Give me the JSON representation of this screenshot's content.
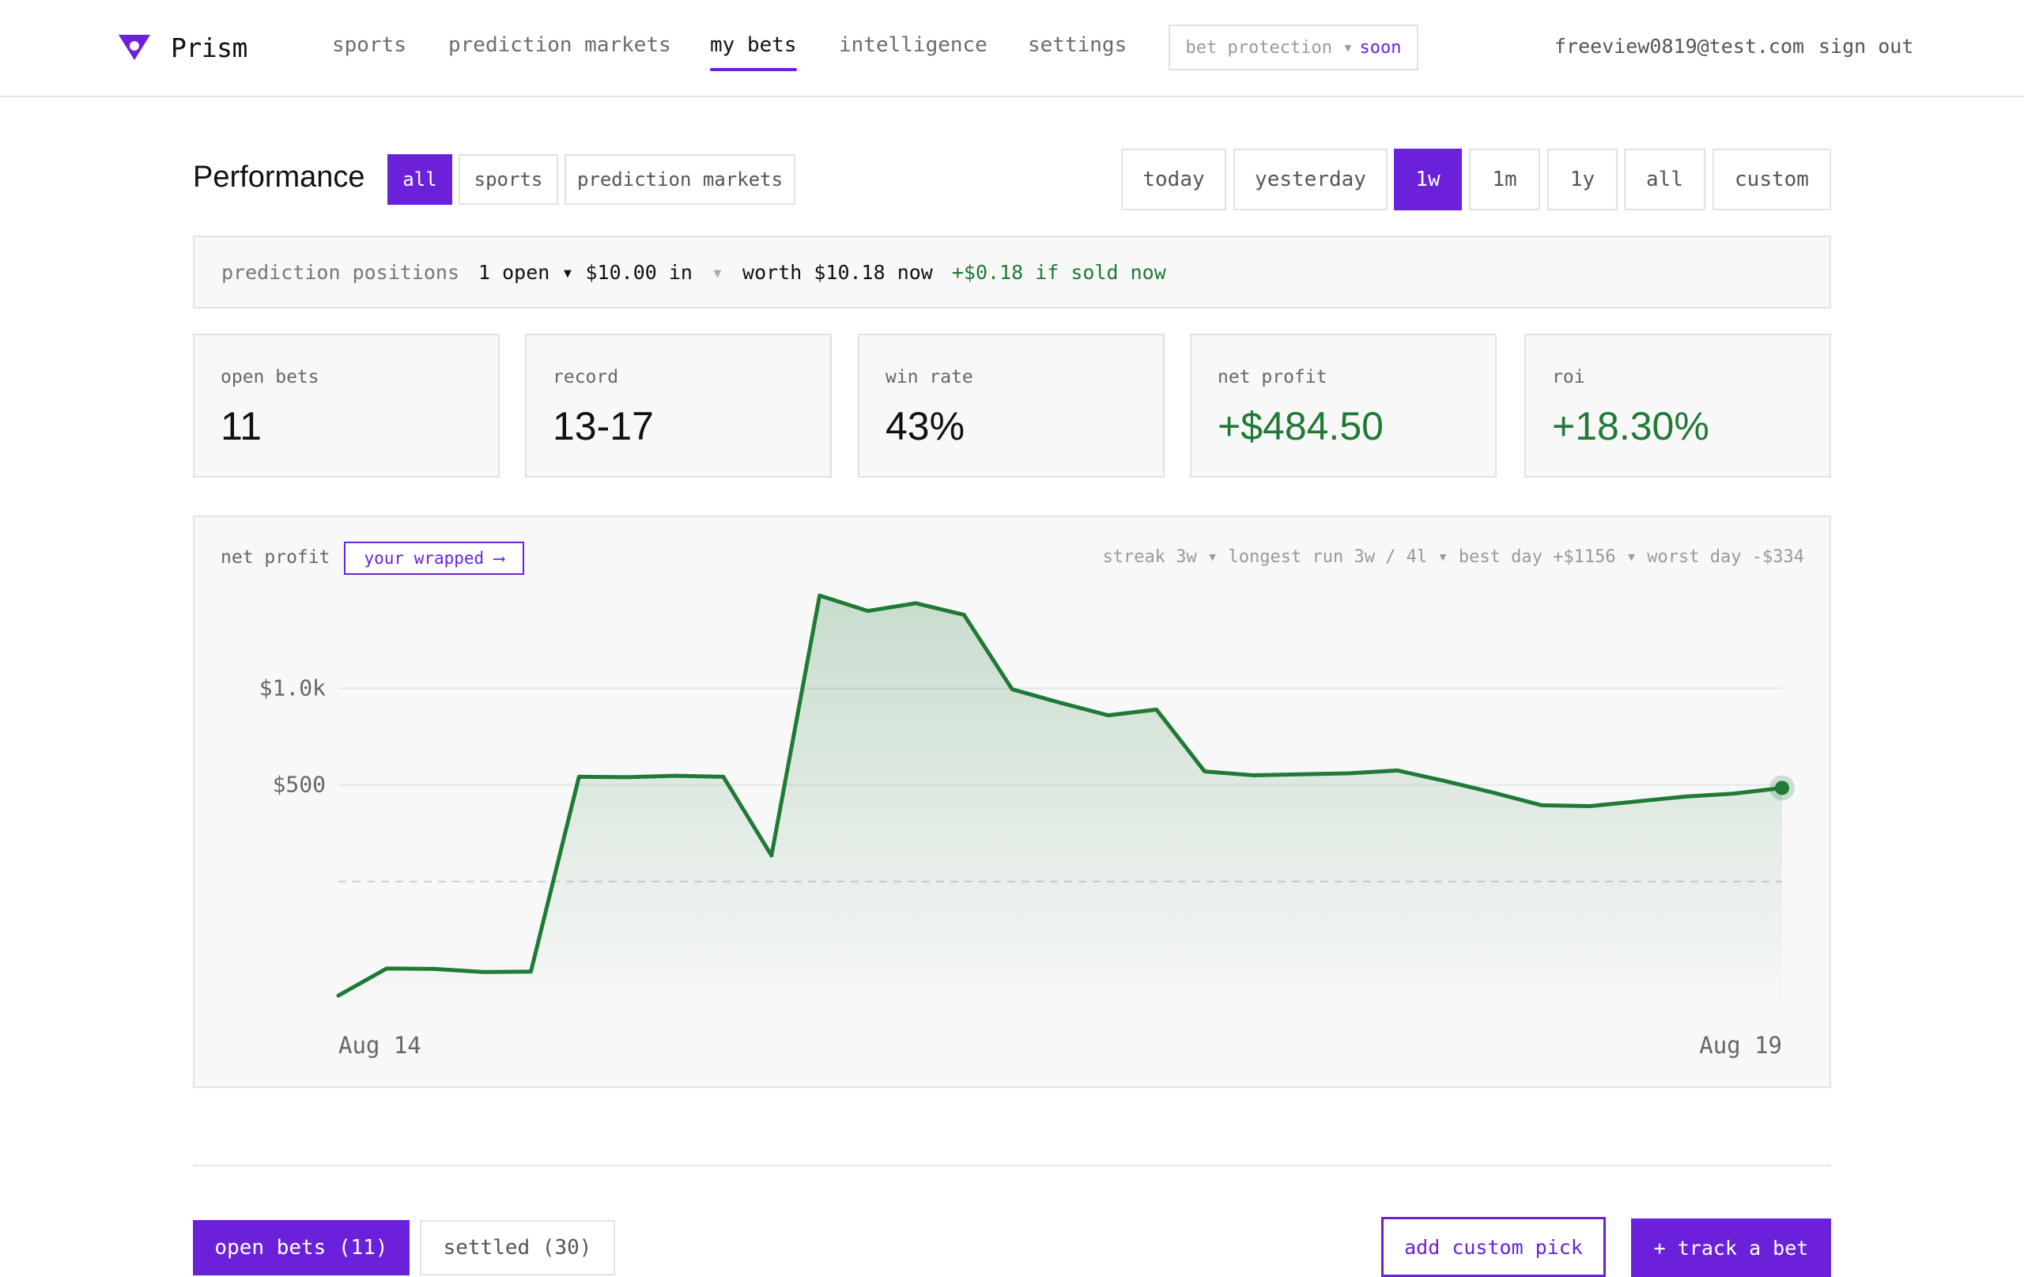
{
  "app": {
    "name": "Prism"
  },
  "nav": {
    "links": [
      {
        "label": "sports"
      },
      {
        "label": "prediction markets"
      },
      {
        "label": "my bets",
        "active": true
      },
      {
        "label": "intelligence"
      },
      {
        "label": "settings"
      }
    ],
    "bet_protection": {
      "label": "bet protection ▾",
      "badge": "soon"
    },
    "user_email": "freeview0819@test.com",
    "sign_out": "sign out"
  },
  "performance": {
    "title": "Performance",
    "filters": [
      {
        "label": "all",
        "selected": true
      },
      {
        "label": "sports"
      },
      {
        "label": "prediction markets"
      }
    ],
    "ranges": [
      {
        "label": "today"
      },
      {
        "label": "yesterday"
      },
      {
        "label": "1w",
        "selected": true
      },
      {
        "label": "1m"
      },
      {
        "label": "1y"
      },
      {
        "label": "all"
      },
      {
        "label": "custom"
      }
    ]
  },
  "prediction_positions": {
    "label": "prediction positions",
    "summary": "1 open ▾ $10.00 in",
    "separator": "▾",
    "worth": "worth $10.18 now",
    "gain": "+$0.18 if sold now"
  },
  "stats": [
    {
      "label": "open bets",
      "value": "11",
      "positive": false
    },
    {
      "label": "record",
      "value": "13-17",
      "positive": false
    },
    {
      "label": "win rate",
      "value": "43%",
      "positive": false
    },
    {
      "label": "net profit",
      "value": "+$484.50",
      "positive": true
    },
    {
      "label": "roi",
      "value": "+18.30%",
      "positive": true
    }
  ],
  "chart_panel": {
    "label": "net profit",
    "wrapped_button": "your wrapped ⟶",
    "stats_line": "streak 3w ▾ longest run 3w / 4l ▾ best day +$1156 ▾ worst day -$334"
  },
  "chart_data": {
    "type": "area",
    "title": "",
    "series": [
      {
        "values": [
          -590,
          -450,
          -452,
          -468,
          -466,
          542,
          540,
          547,
          542,
          135,
          1480,
          1400,
          1440,
          1380,
          995,
          925,
          860,
          890,
          570,
          550,
          555,
          560,
          575,
          520,
          460,
          395,
          390,
          415,
          440,
          455,
          484.5
        ]
      }
    ],
    "x_start_label": "Aug 14",
    "x_end_label": "Aug 19",
    "y_ticks": [
      {
        "value": 1000,
        "label": "$1.0k"
      },
      {
        "value": 500,
        "label": "$500"
      }
    ],
    "baseline": 0,
    "ylim": [
      -700,
      1550
    ],
    "colors": {
      "line": "#1f7a35",
      "fill": "#1f7a35",
      "grid": "#e6e6e6"
    }
  },
  "bottom": {
    "tabs": [
      {
        "label": "open bets (11)",
        "selected": true
      },
      {
        "label": "settled (30)"
      }
    ],
    "add_custom_pick": "add custom pick",
    "track_bet": "+ track a bet"
  },
  "colors": {
    "accent": "#6b21d9",
    "positive": "#1f7a35"
  }
}
